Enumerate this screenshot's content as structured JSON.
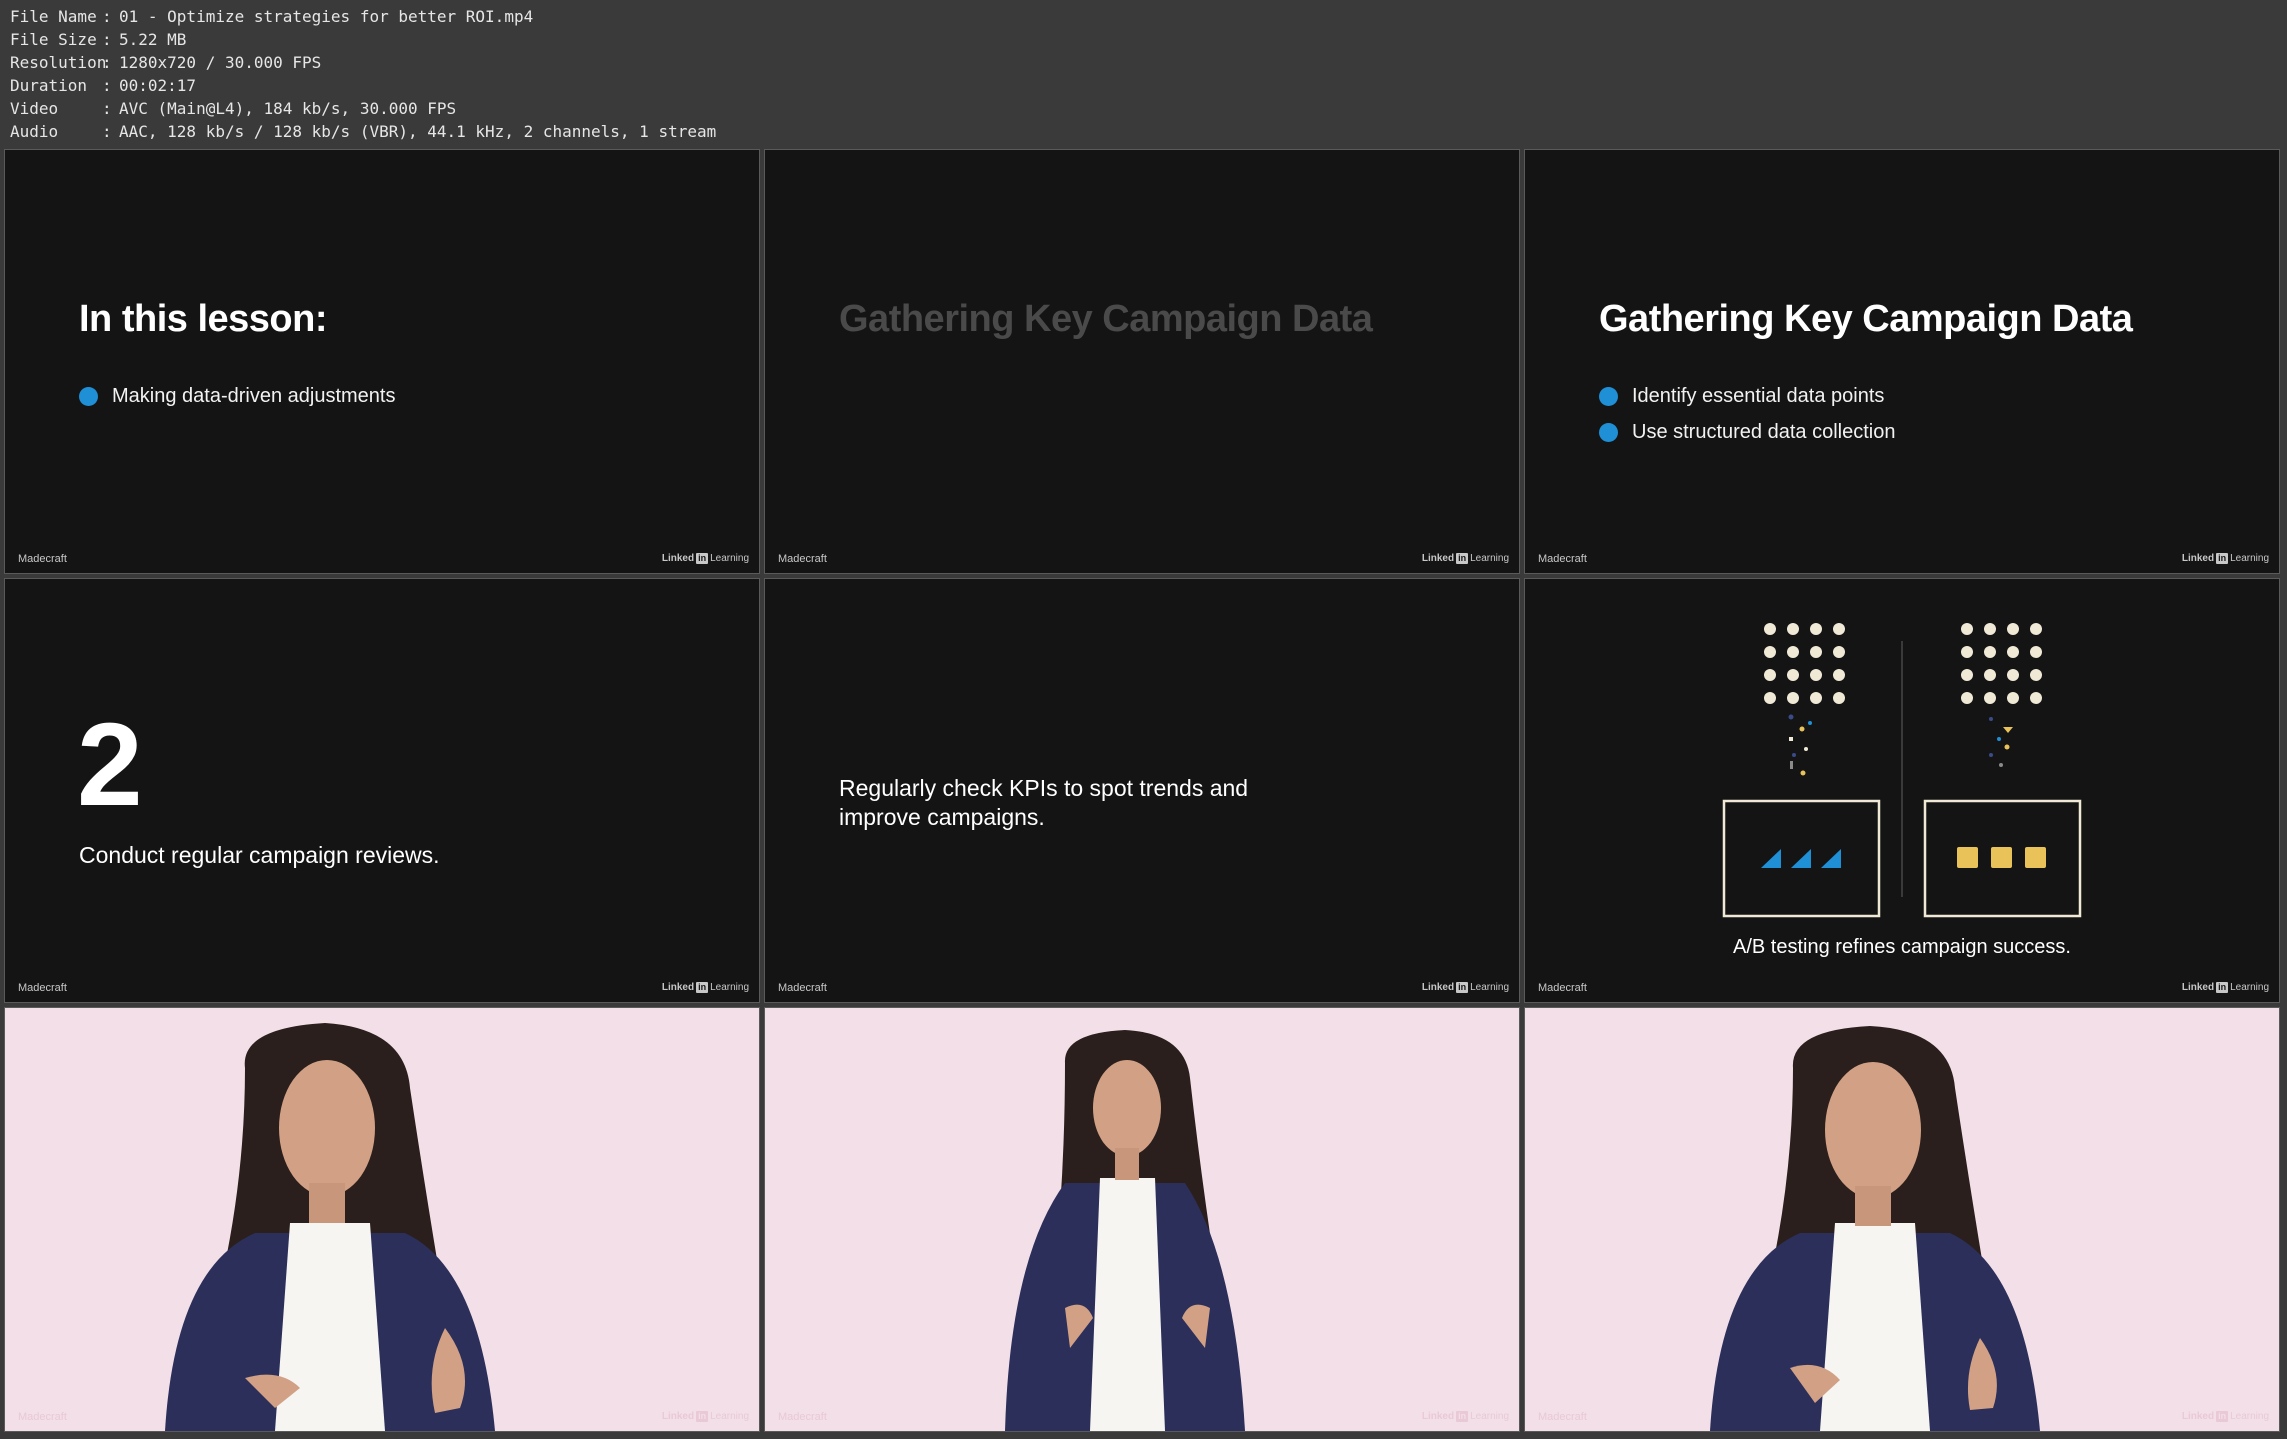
{
  "info": {
    "rows": [
      {
        "key": "File Name",
        "value": "01 - Optimize strategies for better ROI.mp4"
      },
      {
        "key": "File Size",
        "value": "5.22 MB"
      },
      {
        "key": "Resolution",
        "value": "1280x720 / 30.000 FPS"
      },
      {
        "key": "Duration",
        "value": "00:02:17"
      },
      {
        "key": "Video",
        "value": "AVC (Main@L4), 184 kb/s, 30.000 FPS"
      },
      {
        "key": "Audio",
        "value": "AAC, 128 kb/s / 128 kb/s (VBR), 44.1 kHz, 2 channels, 1 stream"
      }
    ]
  },
  "branding": {
    "left": "Madecraft",
    "right_prefix": "Linked",
    "right_in": "in",
    "right_suffix": "Learning"
  },
  "frames": {
    "f1": {
      "title": "In this lesson:",
      "bullets": [
        "Making data-driven adjustments"
      ]
    },
    "f2": {
      "title": "Gathering Key Campaign Data"
    },
    "f3": {
      "title": "Gathering Key Campaign Data",
      "bullets": [
        "Identify essential data points",
        "Use structured data collection"
      ]
    },
    "f4": {
      "number": "2",
      "caption": "Conduct regular campaign reviews."
    },
    "f5": {
      "text": "Regularly check KPIs to spot trends and improve campaigns."
    },
    "f6": {
      "caption": "A/B testing refines campaign success."
    }
  },
  "colors": {
    "bullet": "#1f8fd6",
    "accent_blue": "#1f8fd6",
    "accent_yellow": "#e9c25a",
    "slide_bg": "#141414",
    "photo_bg": "#f3dfe8",
    "jacket": "#2b2f5a"
  }
}
